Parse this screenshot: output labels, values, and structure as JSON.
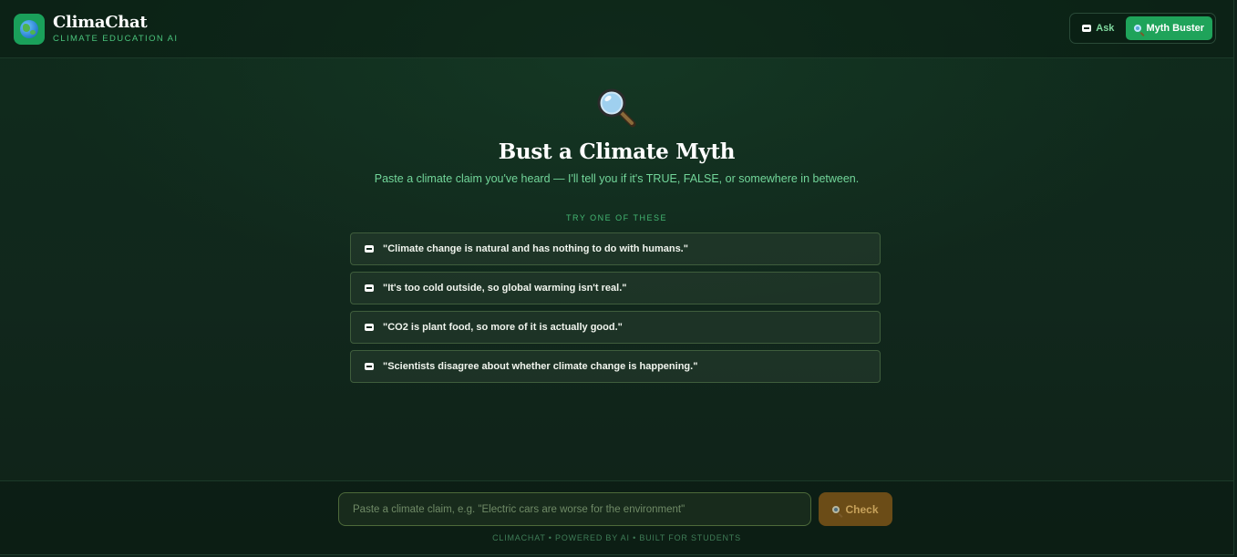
{
  "header": {
    "app_title": "ClimaChat",
    "app_subtitle": "CLIMATE EDUCATION AI",
    "modes": [
      {
        "label": "Ask",
        "icon": "chat-icon",
        "active": false
      },
      {
        "label": "Myth Buster",
        "icon": "magnifier-icon",
        "active": true
      }
    ]
  },
  "hero": {
    "icon": "magnifier-icon",
    "title": "Bust a Climate Myth",
    "subtitle": "Paste a climate claim you've heard — I'll tell you if it's TRUE, FALSE, or somewhere in between."
  },
  "suggestions": {
    "label": "TRY ONE OF THESE",
    "items": [
      "\"Climate change is natural and has nothing to do with humans.\"",
      "\"It's too cold outside, so global warming isn't real.\"",
      "\"CO2 is plant food, so more of it is actually good.\"",
      "\"Scientists disagree about whether climate change is happening.\""
    ]
  },
  "composer": {
    "placeholder": "Paste a climate claim, e.g. \"Electric cars are worse for the environment\"",
    "value": "",
    "check_label": "Check"
  },
  "footer": {
    "credits": "CLIMACHAT  •  POWERED BY AI  •  BUILT FOR STUDENTS"
  },
  "colors": {
    "accent": "#1fa35a",
    "background": "#0f2b1c",
    "check_button": "#6b4c17"
  }
}
